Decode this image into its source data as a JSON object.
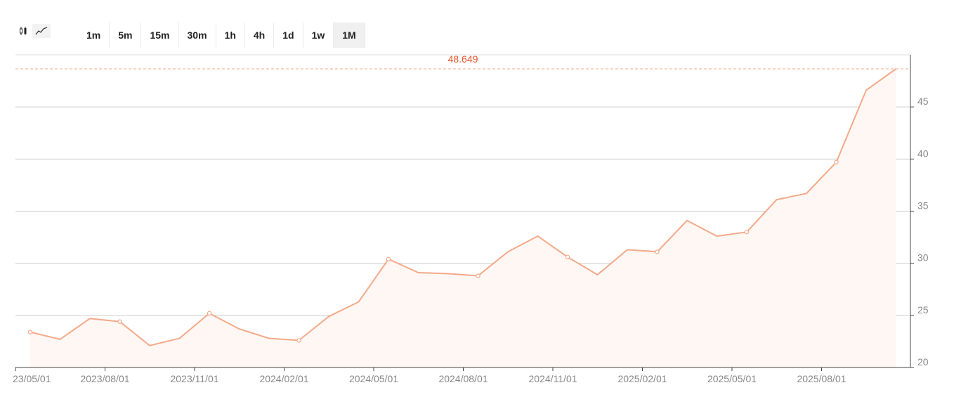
{
  "toolbar": {
    "chart_types": [
      {
        "name": "candlestick-icon",
        "active": false
      },
      {
        "name": "line-chart-icon",
        "active": true
      }
    ],
    "intervals": [
      "1m",
      "5m",
      "15m",
      "30m",
      "1h",
      "4h",
      "1d",
      "1w",
      "1M"
    ],
    "active_interval": "1M"
  },
  "colors": {
    "line": "#f4a989",
    "area": "#fef7f3",
    "price_label": "#e4572e",
    "grid": "#cccccc",
    "axis": "#444444"
  },
  "chart_data": {
    "type": "area",
    "title": "",
    "xlabel": "",
    "ylabel": "",
    "last_price_label": "48.649",
    "ylim": [
      20,
      50
    ],
    "y_ticks": [
      20,
      25,
      30,
      35,
      40,
      45
    ],
    "y_tick_labels": [
      "20",
      "25",
      "30",
      "35",
      "40",
      "45"
    ],
    "x_tick_labels": [
      "23/05/01",
      "2023/08/01",
      "2023/11/01",
      "2024/02/01",
      "2024/05/01",
      "2024/08/01",
      "2024/11/01",
      "2025/02/01",
      "2025/05/01",
      "2025/08/01"
    ],
    "grid": true,
    "y_axis_position": "right",
    "series": [
      {
        "x": [
          "2023/05",
          "2023/06",
          "2023/07",
          "2023/08",
          "2023/09",
          "2023/10",
          "2023/11",
          "2023/12",
          "2024/01",
          "2024/02",
          "2024/03",
          "2024/04",
          "2024/05",
          "2024/06",
          "2024/07",
          "2024/08",
          "2024/09",
          "2024/10",
          "2024/11",
          "2024/12",
          "2025/01",
          "2025/02",
          "2025/03",
          "2025/04",
          "2025/05",
          "2025/06",
          "2025/07",
          "2025/08",
          "2025/09",
          "2025/10"
        ],
        "values": [
          23.4,
          22.7,
          24.7,
          24.4,
          22.1,
          22.8,
          25.2,
          23.7,
          22.8,
          22.6,
          24.9,
          26.3,
          30.4,
          29.1,
          29.0,
          28.8,
          31.1,
          32.6,
          30.6,
          28.9,
          31.3,
          31.1,
          34.1,
          32.6,
          33.0,
          36.1,
          36.7,
          39.7,
          46.6,
          48.649
        ]
      }
    ]
  }
}
